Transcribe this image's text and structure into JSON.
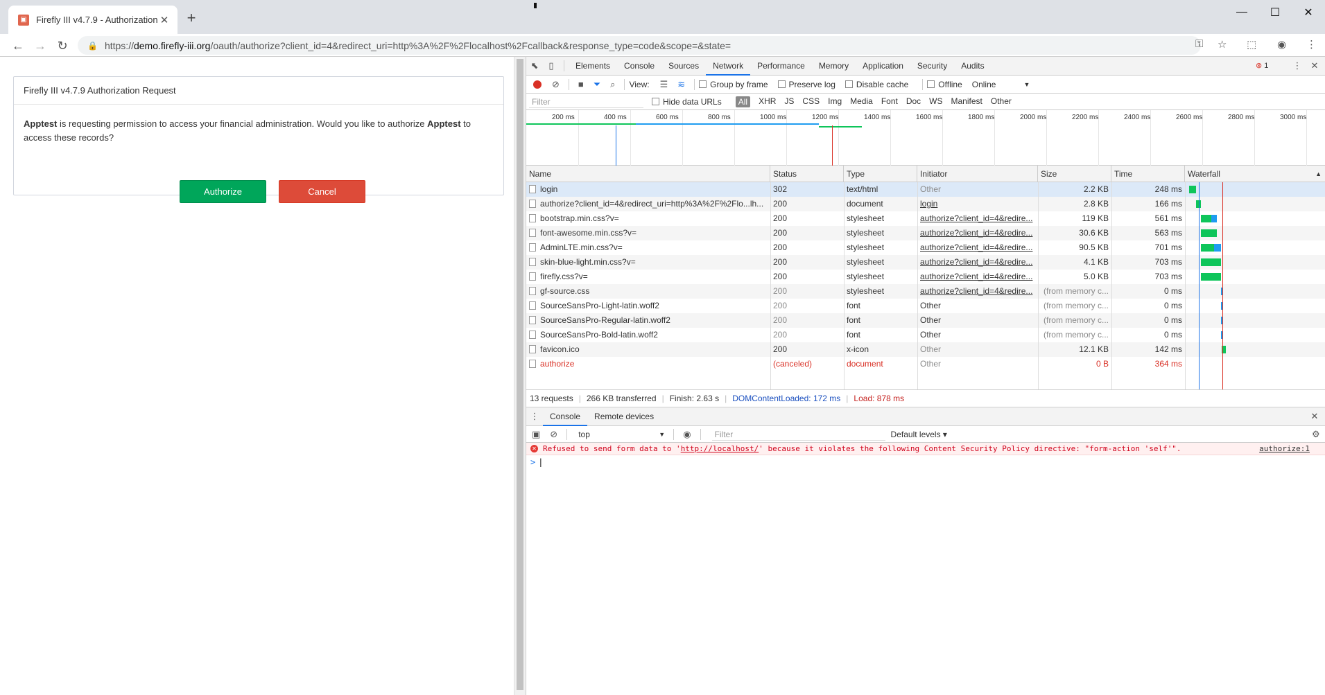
{
  "browser": {
    "tab_title": "Firefly III v4.7.9 - Authorization",
    "tab_close": "✕",
    "new_tab": "+",
    "url_prefix": "https://",
    "url_host": "demo.firefly-iii.org",
    "url_path": "/oauth/authorize?client_id=4&redirect_uri=http%3A%2F%2Flocalhost%2Fcallback&response_type=code&scope=&state=",
    "icons": [
      "back-icon",
      "forward-icon",
      "reload-icon",
      "lock-icon",
      "key-icon",
      "star-icon",
      "extension-icon",
      "account-icon",
      "menu-icon"
    ]
  },
  "page": {
    "panel_title": "Firefly III v4.7.9 Authorization Request",
    "body_app": "Apptest",
    "body_mid": " is requesting permission to access your financial administration. Would you like to authorize ",
    "body_app2": "Apptest",
    "body_end": " to access these records?",
    "authorize_label": "Authorize",
    "cancel_label": "Cancel",
    "authorize_color": "#00a65a",
    "cancel_color": "#dd4b39"
  },
  "devtools": {
    "tabs": [
      "Elements",
      "Console",
      "Sources",
      "Network",
      "Performance",
      "Memory",
      "Application",
      "Security",
      "Audits"
    ],
    "active_tab": "Network",
    "error_count": "1",
    "toolbar": {
      "view_label": "View:",
      "group_by_frame": "Group by frame",
      "preserve_log": "Preserve log",
      "disable_cache": "Disable cache",
      "offline": "Offline",
      "online": "Online"
    },
    "filter": {
      "placeholder": "Filter",
      "hide_data_urls": "Hide data URLs",
      "types": [
        "All",
        "XHR",
        "JS",
        "CSS",
        "Img",
        "Media",
        "Font",
        "Doc",
        "WS",
        "Manifest",
        "Other"
      ]
    },
    "overview_ticks": [
      "200 ms",
      "400 ms",
      "600 ms",
      "800 ms",
      "1000 ms",
      "1200 ms",
      "1400 ms",
      "1600 ms",
      "1800 ms",
      "2000 ms",
      "2200 ms",
      "2400 ms",
      "2600 ms",
      "2800 ms",
      "3000 ms"
    ],
    "columns": [
      "Name",
      "Status",
      "Type",
      "Initiator",
      "Size",
      "Time",
      "Waterfall"
    ],
    "requests": [
      {
        "name": "login",
        "status": "302",
        "type": "text/html",
        "initiator": "Other",
        "size": "2.2 KB",
        "time": "248 ms",
        "wf_start": 0,
        "wf_end": 248
      },
      {
        "name": "authorize?client_id=4&redirect_uri=http%3A%2F%2Flo...lh...",
        "status": "200",
        "type": "document",
        "initiator": "login",
        "size": "2.8 KB",
        "time": "166 ms",
        "wf_start": 250,
        "wf_end": 416
      },
      {
        "name": "bootstrap.min.css?v=",
        "status": "200",
        "type": "stylesheet",
        "initiator": "authorize?client_id=4&redire...",
        "size": "119 KB",
        "time": "561 ms",
        "wf_start": 420,
        "wf_end": 981
      },
      {
        "name": "font-awesome.min.css?v=",
        "status": "200",
        "type": "stylesheet",
        "initiator": "authorize?client_id=4&redire...",
        "size": "30.6 KB",
        "time": "563 ms",
        "wf_start": 420,
        "wf_end": 983
      },
      {
        "name": "AdminLTE.min.css?v=",
        "status": "200",
        "type": "stylesheet",
        "initiator": "authorize?client_id=4&redire...",
        "size": "90.5 KB",
        "time": "701 ms",
        "wf_start": 420,
        "wf_end": 1121
      },
      {
        "name": "skin-blue-light.min.css?v=",
        "status": "200",
        "type": "stylesheet",
        "initiator": "authorize?client_id=4&redire...",
        "size": "4.1 KB",
        "time": "703 ms",
        "wf_start": 420,
        "wf_end": 1123
      },
      {
        "name": "firefly.css?v=",
        "status": "200",
        "type": "stylesheet",
        "initiator": "authorize?client_id=4&redire...",
        "size": "5.0 KB",
        "time": "703 ms",
        "wf_start": 420,
        "wf_end": 1123
      },
      {
        "name": "gf-source.css",
        "status": "200",
        "type": "stylesheet",
        "initiator": "authorize?client_id=4&redire...",
        "size": "(from memory c...",
        "time": "0 ms",
        "wf_start": 1125,
        "wf_end": 1130
      },
      {
        "name": "SourceSansPro-Light-latin.woff2",
        "status": "200",
        "type": "font",
        "initiator": "Other",
        "size": "(from memory c...",
        "time": "0 ms",
        "wf_start": 1130,
        "wf_end": 1135
      },
      {
        "name": "SourceSansPro-Regular-latin.woff2",
        "status": "200",
        "type": "font",
        "initiator": "Other",
        "size": "(from memory c...",
        "time": "0 ms",
        "wf_start": 1130,
        "wf_end": 1135
      },
      {
        "name": "SourceSansPro-Bold-latin.woff2",
        "status": "200",
        "type": "font",
        "initiator": "Other",
        "size": "(from memory c...",
        "time": "0 ms",
        "wf_start": 1130,
        "wf_end": 1135
      },
      {
        "name": "favicon.ico",
        "status": "200",
        "type": "x-icon",
        "initiator": "Other",
        "size": "12.1 KB",
        "time": "142 ms",
        "wf_start": 1140,
        "wf_end": 1282
      },
      {
        "name": "authorize",
        "status": "(canceled)",
        "type": "document",
        "initiator": "Other",
        "size": "0 B",
        "time": "364 ms",
        "wf_start": 0,
        "wf_end": 0
      }
    ],
    "status": {
      "requests": "13 requests",
      "transferred": "266 KB transferred",
      "finish": "Finish: 2.63 s",
      "dom": "DOMContentLoaded: 172 ms",
      "load": "Load: 878 ms"
    },
    "drawer": {
      "tabs": [
        "Console",
        "Remote devices"
      ],
      "context": "top",
      "filter_placeholder": "Filter",
      "levels": "Default levels ▾",
      "error_pre": "Refused to send form data to '",
      "error_link": "http://localhost/",
      "error_post": "' because it violates the following Content Security Policy directive: \"form-action 'self'\".",
      "error_source": "authorize:1",
      "prompt": ">"
    },
    "colors": {
      "accent": "#1a73e8",
      "error": "#d93025",
      "waterfall_green": "#0ec55a",
      "waterfall_blue": "#1e9cf0"
    }
  }
}
